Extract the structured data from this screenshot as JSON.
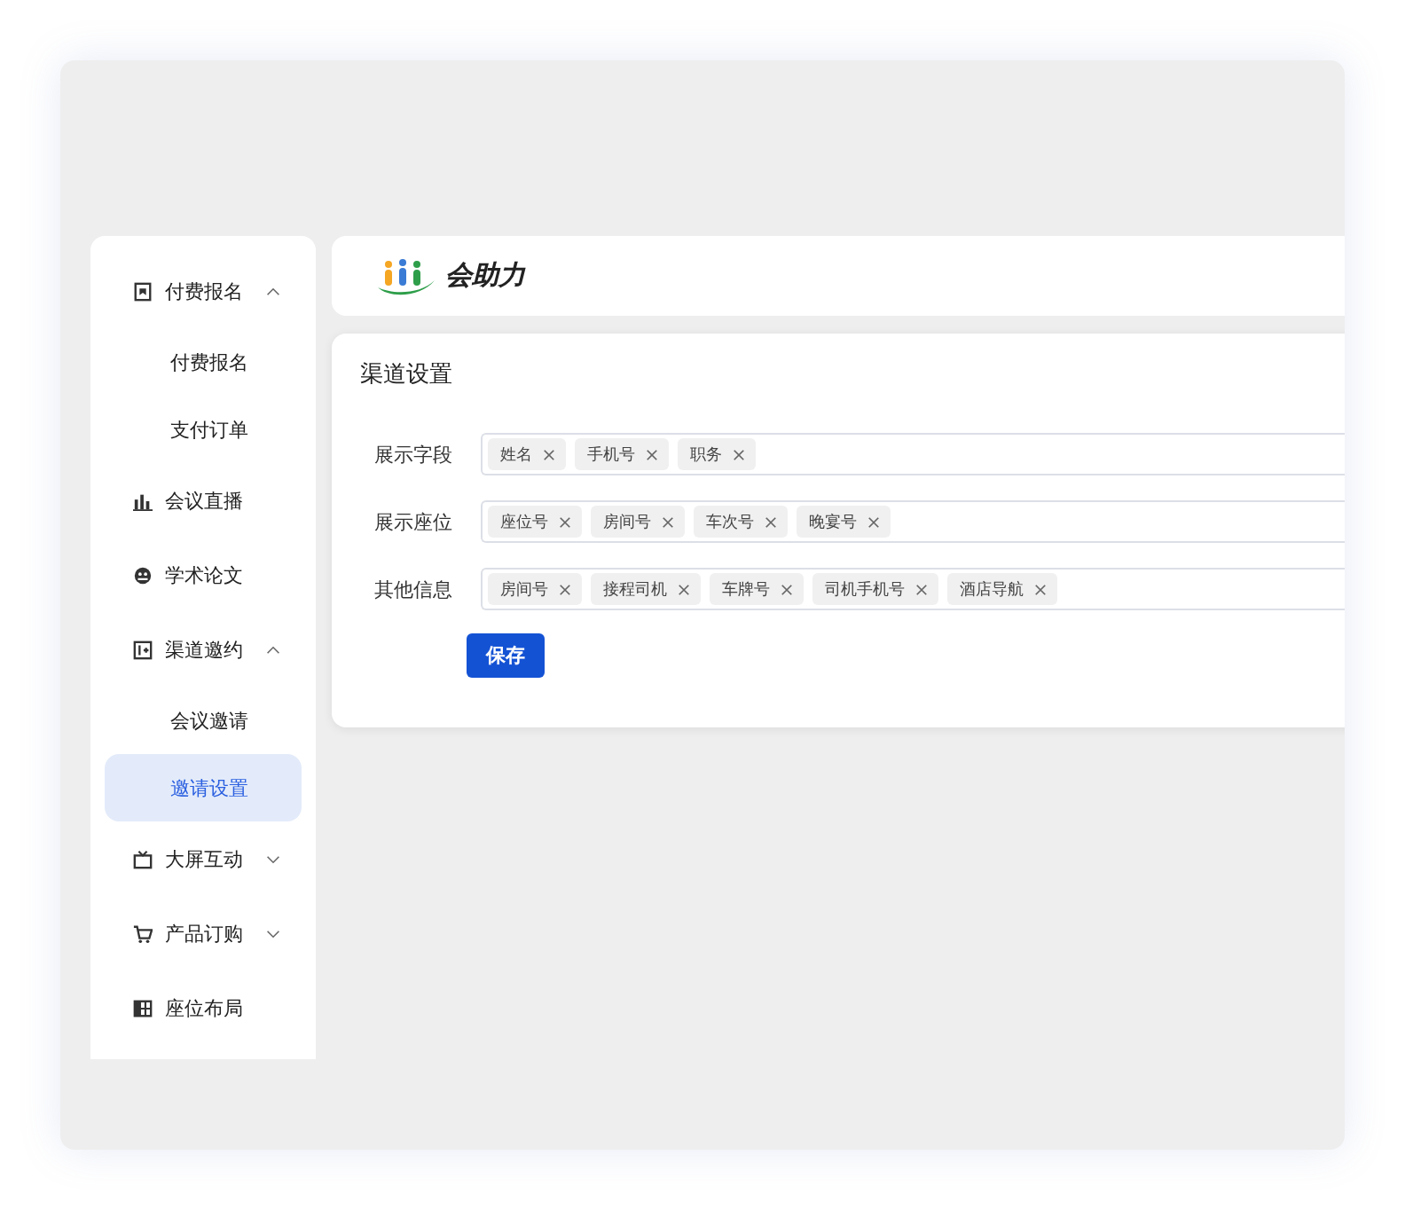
{
  "sidebar": {
    "items": [
      {
        "label": "付费报名",
        "expanded": true,
        "children": [
          {
            "label": "付费报名",
            "selected": false
          },
          {
            "label": "支付订单",
            "selected": false
          }
        ]
      },
      {
        "label": "会议直播"
      },
      {
        "label": "学术论文"
      },
      {
        "label": "渠道邀约",
        "expanded": true,
        "children": [
          {
            "label": "会议邀请",
            "selected": false
          },
          {
            "label": "邀请设置",
            "selected": true
          }
        ]
      },
      {
        "label": "大屏互动",
        "expanded": false
      },
      {
        "label": "产品订购",
        "expanded": false
      },
      {
        "label": "座位布局"
      }
    ]
  },
  "header": {
    "logo_text": "会助力"
  },
  "card": {
    "title": "渠道设置",
    "fields": [
      {
        "label": "展示字段",
        "tags": [
          "姓名",
          "手机号",
          "职务"
        ]
      },
      {
        "label": "展示座位",
        "tags": [
          "座位号",
          "房间号",
          "车次号",
          "晚宴号"
        ]
      },
      {
        "label": "其他信息",
        "tags": [
          "房间号",
          "接程司机",
          "车牌号",
          "司机手机号",
          "酒店导航"
        ]
      }
    ],
    "save_button": "保存"
  }
}
